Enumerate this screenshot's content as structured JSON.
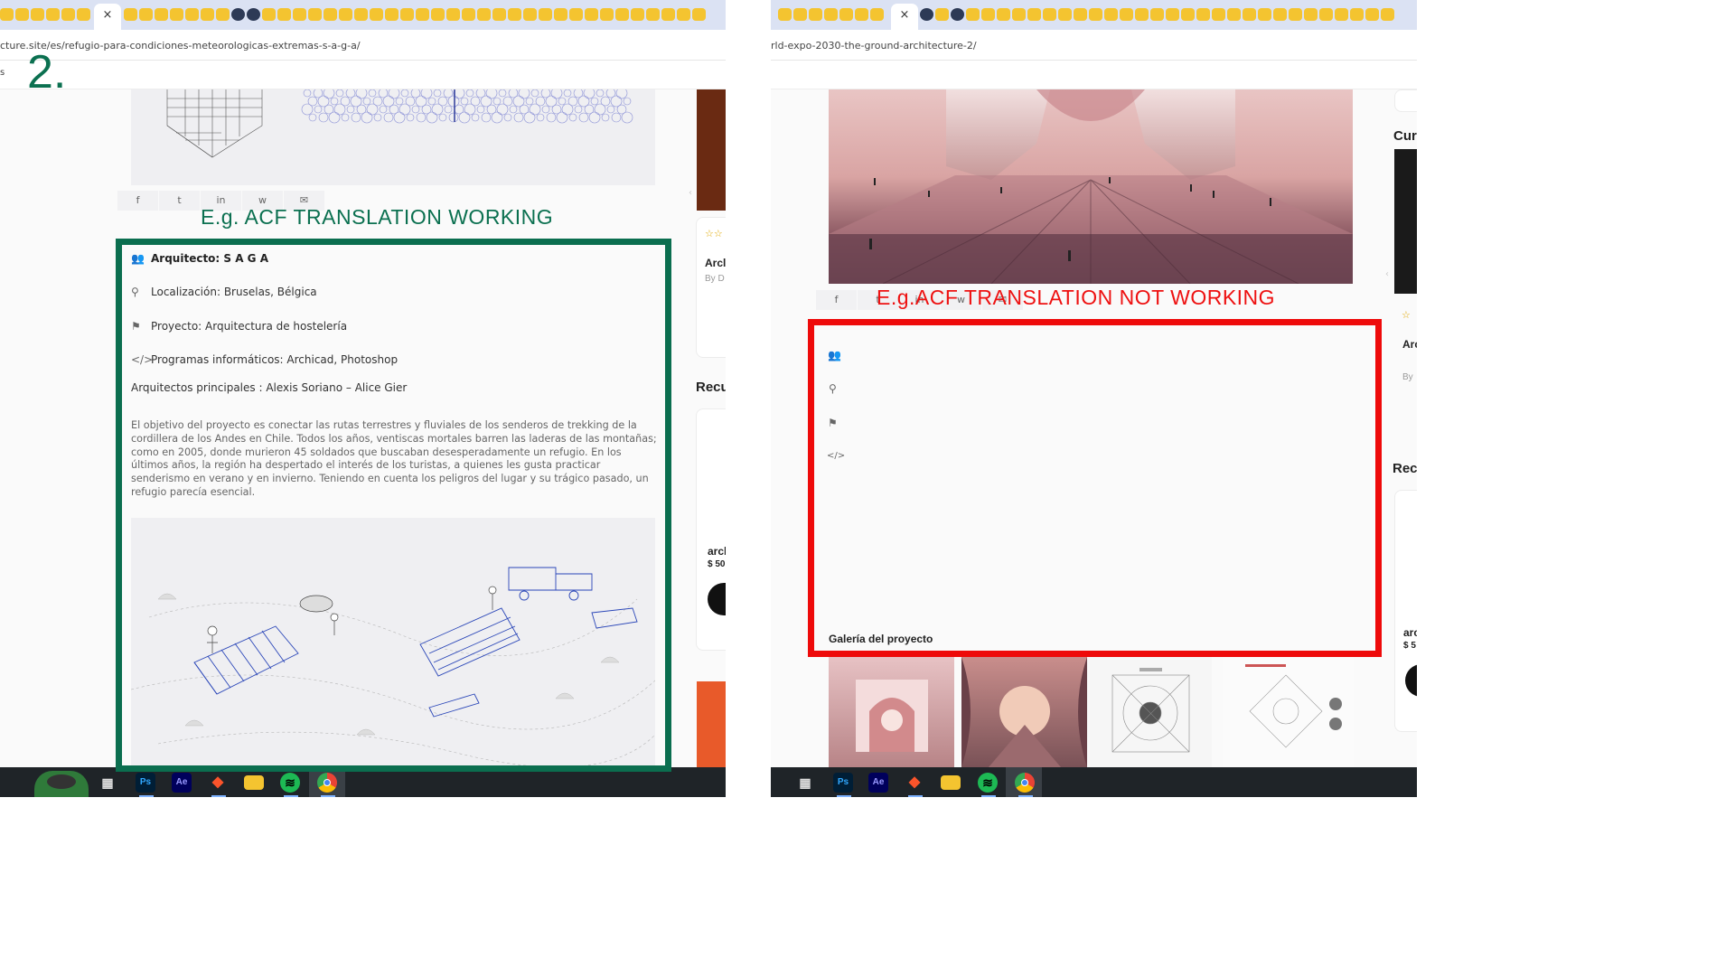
{
  "annotations": {
    "step_number": "2.",
    "working_label": "E.g. ACF TRANSLATION WORKING",
    "not_working_label": "E.g.ACF TRANSLATION  NOT WORKING",
    "working_color": "#0b6e4f",
    "not_working_color": "#ee0a0a"
  },
  "left_browser": {
    "url": "cture.site/es/refugio-para-condiciones-meteorologicas-extremas-s-a-g-a/",
    "tab_close": "×",
    "nav_fragment": "s",
    "share_icons": [
      "facebook-icon",
      "twitter-icon",
      "linkedin-icon",
      "whatsapp-icon",
      "email-icon"
    ],
    "share_glyphs": [
      "f",
      "t",
      "in",
      "w",
      "✉"
    ],
    "meta": {
      "architect": "Arquitecto: S A G A",
      "location": "Localización: Bruselas, Bélgica",
      "project": "Proyecto: Arquitectura de hostelería",
      "software": "Programas informáticos: Archicad, Photoshop",
      "lead_architects": "Arquitectos principales : Alexis Soriano – Alice Gier"
    },
    "description": "El objetivo del proyecto es conectar las rutas terrestres y fluviales de los senderos de trekking de la cordillera de los Andes en Chile. Todos los años, ventiscas mortales barren las laderas de las montañas; como en 2005, donde murieron 45 soldados que buscaban desesperadamente un refugio. En los últimos años, la región ha despertado el interés de los turistas, a quienes les gusta practicar senderismo en verano y en invierno. Teniendo en cuenta los peligros del lugar y su trágico pasado, un refugio parecía esencial.",
    "sidebar": {
      "card_title_fragment": "Arcl",
      "card_author_fragment": "By D",
      "section_heading_fragment": "Recu",
      "product_name_fragment": "arcl",
      "product_price_fragment": "$ 50"
    }
  },
  "right_browser": {
    "url": "rld-expo-2030-the-ground-architecture-2/",
    "tab_close": "×",
    "gallery_title": "Galería del proyecto",
    "sidebar": {
      "heading_fragment_1": "Cur",
      "card_title_fragment": "Arc",
      "card_author_fragment": "By",
      "heading_fragment_2": "Rec",
      "product_name_fragment": "arc",
      "product_price_fragment": "$ 5"
    }
  },
  "taskbar": {
    "apps": [
      "Ps",
      "Ae"
    ]
  }
}
